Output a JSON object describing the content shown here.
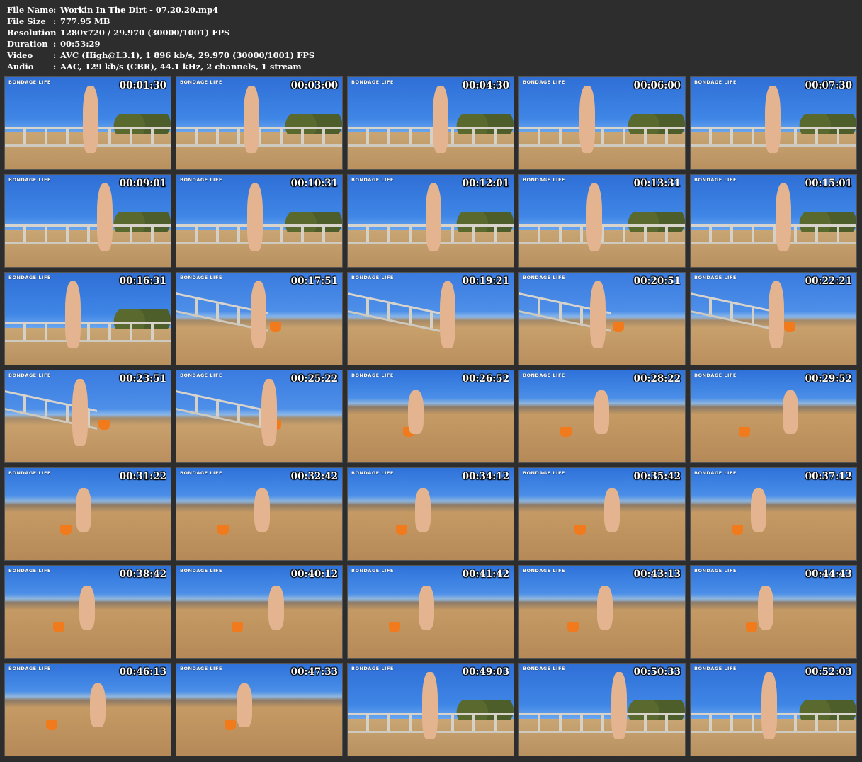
{
  "info": {
    "rows": [
      {
        "key": "File Name",
        "sep": ":",
        "value": "Workin In The Dirt - 07.20.20.mp4"
      },
      {
        "key": "File Size",
        "sep": ":",
        "value": "777.95 MB"
      },
      {
        "key": "Resolution",
        "sep": ":",
        "value": "1280x720 / 29.970 (30000/1001) FPS"
      },
      {
        "key": "Duration",
        "sep": ":",
        "value": "00:53:29"
      },
      {
        "key": "Video",
        "sep": ":",
        "value": "AVC (High@L3.1), 1 896 kb/s, 29.970 (30000/1001) FPS"
      },
      {
        "key": "Audio",
        "sep": ":",
        "value": "AAC, 129 kb/s (CBR), 44.1 kHz, 2 channels, 1 stream"
      }
    ]
  },
  "watermark": "BONDAGE LIFE",
  "thumbnails": [
    {
      "time": "00:01:30",
      "scene": "a"
    },
    {
      "time": "00:03:00",
      "scene": "a"
    },
    {
      "time": "00:04:30",
      "scene": "a"
    },
    {
      "time": "00:06:00",
      "scene": "a"
    },
    {
      "time": "00:07:30",
      "scene": "a"
    },
    {
      "time": "00:09:01",
      "scene": "a"
    },
    {
      "time": "00:10:31",
      "scene": "a"
    },
    {
      "time": "00:12:01",
      "scene": "a"
    },
    {
      "time": "00:13:31",
      "scene": "a"
    },
    {
      "time": "00:15:01",
      "scene": "a"
    },
    {
      "time": "00:16:31",
      "scene": "a"
    },
    {
      "time": "00:17:51",
      "scene": "b"
    },
    {
      "time": "00:19:21",
      "scene": "b"
    },
    {
      "time": "00:20:51",
      "scene": "b"
    },
    {
      "time": "00:22:21",
      "scene": "b"
    },
    {
      "time": "00:23:51",
      "scene": "b"
    },
    {
      "time": "00:25:22",
      "scene": "b"
    },
    {
      "time": "00:26:52",
      "scene": "c"
    },
    {
      "time": "00:28:22",
      "scene": "c"
    },
    {
      "time": "00:29:52",
      "scene": "c"
    },
    {
      "time": "00:31:22",
      "scene": "c"
    },
    {
      "time": "00:32:42",
      "scene": "c"
    },
    {
      "time": "00:34:12",
      "scene": "c"
    },
    {
      "time": "00:35:42",
      "scene": "c"
    },
    {
      "time": "00:37:12",
      "scene": "c"
    },
    {
      "time": "00:38:42",
      "scene": "c"
    },
    {
      "time": "00:40:12",
      "scene": "c"
    },
    {
      "time": "00:41:42",
      "scene": "c"
    },
    {
      "time": "00:43:13",
      "scene": "c"
    },
    {
      "time": "00:44:43",
      "scene": "c"
    },
    {
      "time": "00:46:13",
      "scene": "c"
    },
    {
      "time": "00:47:33",
      "scene": "c"
    },
    {
      "time": "00:49:03",
      "scene": "a"
    },
    {
      "time": "00:50:33",
      "scene": "a"
    },
    {
      "time": "00:52:03",
      "scene": "a"
    }
  ],
  "colors": {
    "background": "#2d2d2d",
    "text": "#ffffff",
    "bucket": "#f07a1c"
  }
}
